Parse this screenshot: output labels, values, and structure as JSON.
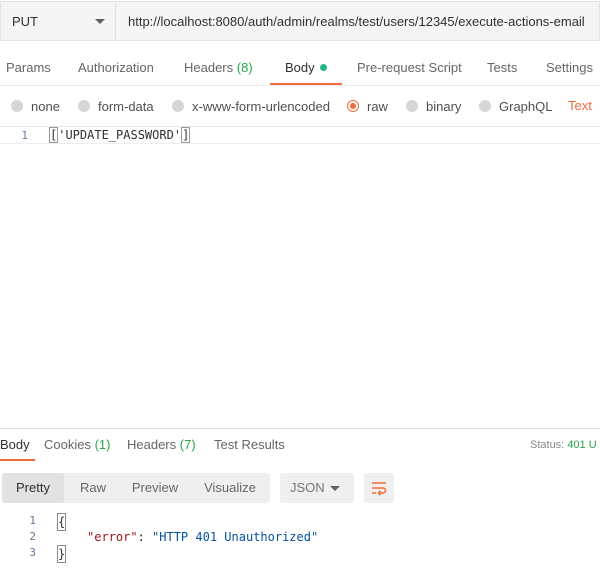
{
  "request": {
    "method": "PUT",
    "url": "http://localhost:8080/auth/admin/realms/test/users/12345/execute-actions-email"
  },
  "request_tabs": [
    {
      "label": "Params"
    },
    {
      "label": "Authorization"
    },
    {
      "label": "Headers",
      "count": "(8)"
    },
    {
      "label": "Body"
    },
    {
      "label": "Pre-request Script"
    },
    {
      "label": "Tests"
    },
    {
      "label": "Settings"
    }
  ],
  "body_types": [
    {
      "label": "none"
    },
    {
      "label": "form-data"
    },
    {
      "label": "x-www-form-urlencoded"
    },
    {
      "label": "raw",
      "selected": true
    },
    {
      "label": "binary"
    },
    {
      "label": "GraphQL"
    }
  ],
  "body_format": "Text",
  "editor": {
    "lines": [
      {
        "number": "1",
        "open": "[",
        "content": "'UPDATE_PASSWORD'",
        "close": "]"
      }
    ]
  },
  "response": {
    "tabs": [
      {
        "label": "Body"
      },
      {
        "label": "Cookies",
        "count": "(1)"
      },
      {
        "label": "Headers",
        "count": "(7)"
      },
      {
        "label": "Test Results"
      }
    ],
    "status_label": "Status:",
    "status_value": "401 U",
    "view_modes": [
      "Pretty",
      "Raw",
      "Preview",
      "Visualize"
    ],
    "format": "JSON",
    "lines": [
      {
        "number": "1",
        "text": "{"
      },
      {
        "number": "2",
        "key": "\"error\"",
        "sep": ": ",
        "value": "\"HTTP 401 Unauthorized\""
      },
      {
        "number": "3",
        "text": "}"
      }
    ]
  },
  "colors": {
    "accent": "#f26b3a",
    "indicator": "#26b47f",
    "count": "#28a745"
  },
  "icons": [
    "chevron-down-icon",
    "wrap-lines-icon"
  ]
}
